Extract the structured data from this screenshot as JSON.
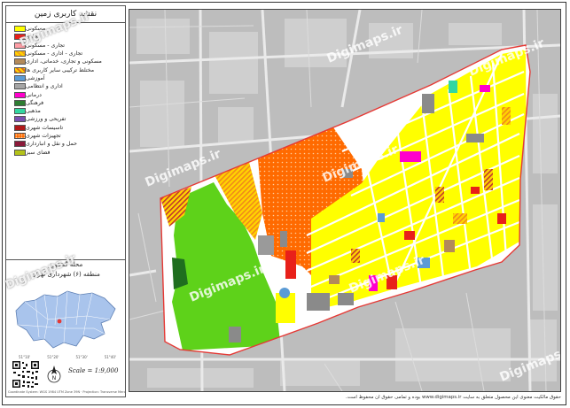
{
  "legend": {
    "title": "نقشه کاربری زمین",
    "items": [
      {
        "label": "مسکونی",
        "color": "#ffff00",
        "pattern": "solid"
      },
      {
        "label": "تجاری",
        "color": "#e8201a",
        "pattern": "solid"
      },
      {
        "label": "تجاری - مسکونی",
        "color": "#ff9ea6",
        "pattern": "solid"
      },
      {
        "label": "تجاری - اداری - مسکونی",
        "color": "#f4a21a",
        "pattern": "hatch"
      },
      {
        "label": "مسکونی و تجاری، خدماتی، اداری",
        "color": "#b38a5a",
        "pattern": "solid"
      },
      {
        "label": "مختلط ترکیبی سایر کاربری ها",
        "color": "#e06a20",
        "pattern": "hatch"
      },
      {
        "label": "آموزشی",
        "color": "#5b9bd5",
        "pattern": "solid"
      },
      {
        "label": "اداری و انتظامی",
        "color": "#a5a5a5",
        "pattern": "solid"
      },
      {
        "label": "درمانی",
        "color": "#ff00cc",
        "pattern": "solid"
      },
      {
        "label": "فرهنگی",
        "color": "#2e7d32",
        "pattern": "solid"
      },
      {
        "label": "مذهبی",
        "color": "#33d6a0",
        "pattern": "solid"
      },
      {
        "label": "تفریحی و ورزشی",
        "color": "#7a4fb0",
        "pattern": "solid"
      },
      {
        "label": "تاسیسات شهری",
        "color": "#b01818",
        "pattern": "solid"
      },
      {
        "label": "تجهیزات شهری",
        "color": "#ff6a00",
        "pattern": "dots"
      },
      {
        "label": "حمل و نقل و انبارداری",
        "color": "#8b1a3a",
        "pattern": "solid"
      },
      {
        "label": "فضای سبز",
        "color": "#b3c21a",
        "pattern": "solid"
      }
    ],
    "place_line1": "محله گشاورز",
    "place_line2": "منطقه (۶) شهرداری تهران",
    "inset_ticks": [
      "51°10'",
      "51°20'",
      "51°30'",
      "51°40'"
    ],
    "scale": "Scale = 1:9,000",
    "north_label": "N",
    "credit": "Coordinate System: WGS 1984 UTM Zone 39N · Projection: Transverse Mercator"
  },
  "map": {
    "watermark": "Digimaps.ir",
    "footer": "حقوق مالکیت معنوی این محصول متعلق به سایت www.digimaps.ir بوده و تمامی حقوق آن محفوظ است."
  }
}
